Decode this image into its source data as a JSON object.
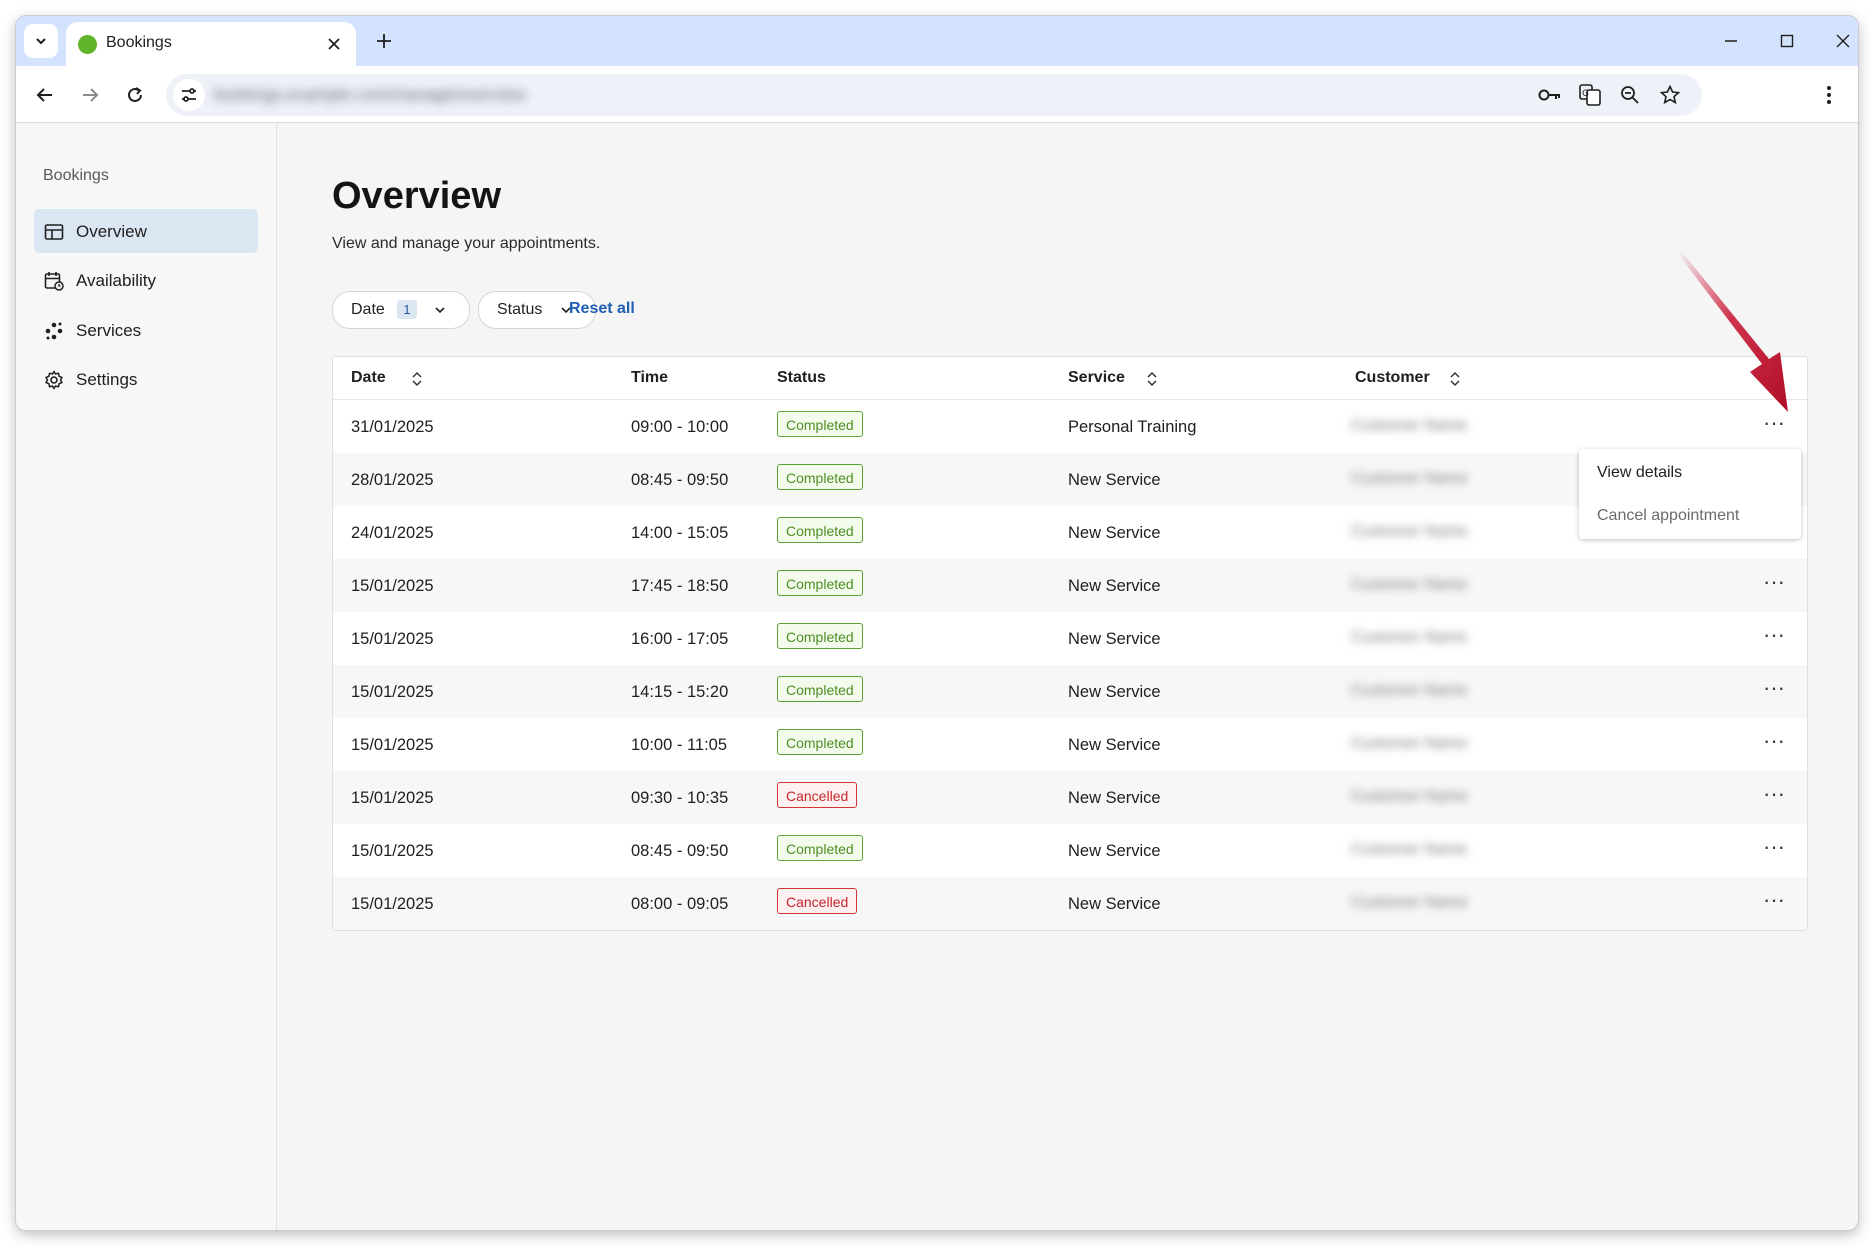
{
  "browser": {
    "tab_title": "Bookings",
    "url": "bookings.example.com/manage/overview"
  },
  "sidebar": {
    "title": "Bookings",
    "items": [
      {
        "label": "Overview",
        "icon": "table-layout-icon",
        "active": true
      },
      {
        "label": "Availability",
        "icon": "calendar-clock-icon",
        "active": false
      },
      {
        "label": "Services",
        "icon": "services-network-icon",
        "active": false
      },
      {
        "label": "Settings",
        "icon": "gear-icon",
        "active": false
      }
    ]
  },
  "page": {
    "title": "Overview",
    "subtitle": "View and manage your appointments."
  },
  "filters": {
    "date_label": "Date",
    "date_count": "1",
    "status_label": "Status",
    "reset_label": "Reset all"
  },
  "table": {
    "columns": [
      "Date",
      "Time",
      "Status",
      "Service",
      "Customer"
    ],
    "rows": [
      {
        "date": "31/01/2025",
        "time": "09:00 - 10:00",
        "status": "Completed",
        "service": "Personal Training",
        "customer": "Customer Name"
      },
      {
        "date": "28/01/2025",
        "time": "08:45 - 09:50",
        "status": "Completed",
        "service": "New Service",
        "customer": "Customer Name"
      },
      {
        "date": "24/01/2025",
        "time": "14:00 - 15:05",
        "status": "Completed",
        "service": "New Service",
        "customer": "Customer Name"
      },
      {
        "date": "15/01/2025",
        "time": "17:45 - 18:50",
        "status": "Completed",
        "service": "New Service",
        "customer": "Customer Name"
      },
      {
        "date": "15/01/2025",
        "time": "16:00 - 17:05",
        "status": "Completed",
        "service": "New Service",
        "customer": "Customer Name"
      },
      {
        "date": "15/01/2025",
        "time": "14:15 - 15:20",
        "status": "Completed",
        "service": "New Service",
        "customer": "Customer Name"
      },
      {
        "date": "15/01/2025",
        "time": "10:00 - 11:05",
        "status": "Completed",
        "service": "New Service",
        "customer": "Customer Name"
      },
      {
        "date": "15/01/2025",
        "time": "09:30 - 10:35",
        "status": "Cancelled",
        "service": "New Service",
        "customer": "Customer Name"
      },
      {
        "date": "15/01/2025",
        "time": "08:45 - 09:50",
        "status": "Completed",
        "service": "New Service",
        "customer": "Customer Name"
      },
      {
        "date": "15/01/2025",
        "time": "08:00 - 09:05",
        "status": "Cancelled",
        "service": "New Service",
        "customer": "Customer Name"
      }
    ],
    "row_menu_label": "···"
  },
  "context_menu": {
    "view_details": "View details",
    "cancel_appointment": "Cancel appointment"
  },
  "colors": {
    "accent": "#1f5fb0",
    "completed": "#4e8e24",
    "cancelled": "#c4262b",
    "annotation_arrow": "#c8102e"
  }
}
